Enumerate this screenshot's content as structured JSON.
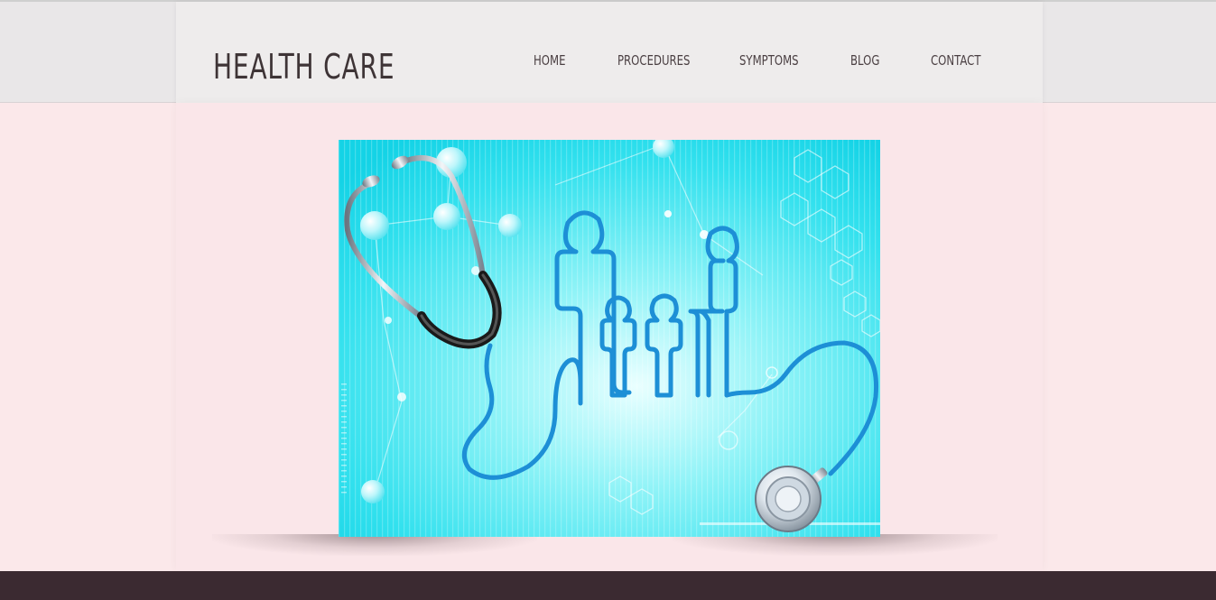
{
  "header": {
    "logo": "HEALTH CARE",
    "nav": [
      {
        "label": "HOME"
      },
      {
        "label": "PROCEDURES"
      },
      {
        "label": "SYMPTOMS"
      },
      {
        "label": "BLOG"
      },
      {
        "label": "CONTACT"
      }
    ]
  },
  "hero": {
    "icon": "stethoscope-family-illustration"
  },
  "colors": {
    "header_bg": "#eeecec",
    "page_bg": "#fae6e9",
    "footer_bg": "#3b2a31",
    "hero_cyan": "#2fe3ef",
    "text": "#3e3436"
  }
}
